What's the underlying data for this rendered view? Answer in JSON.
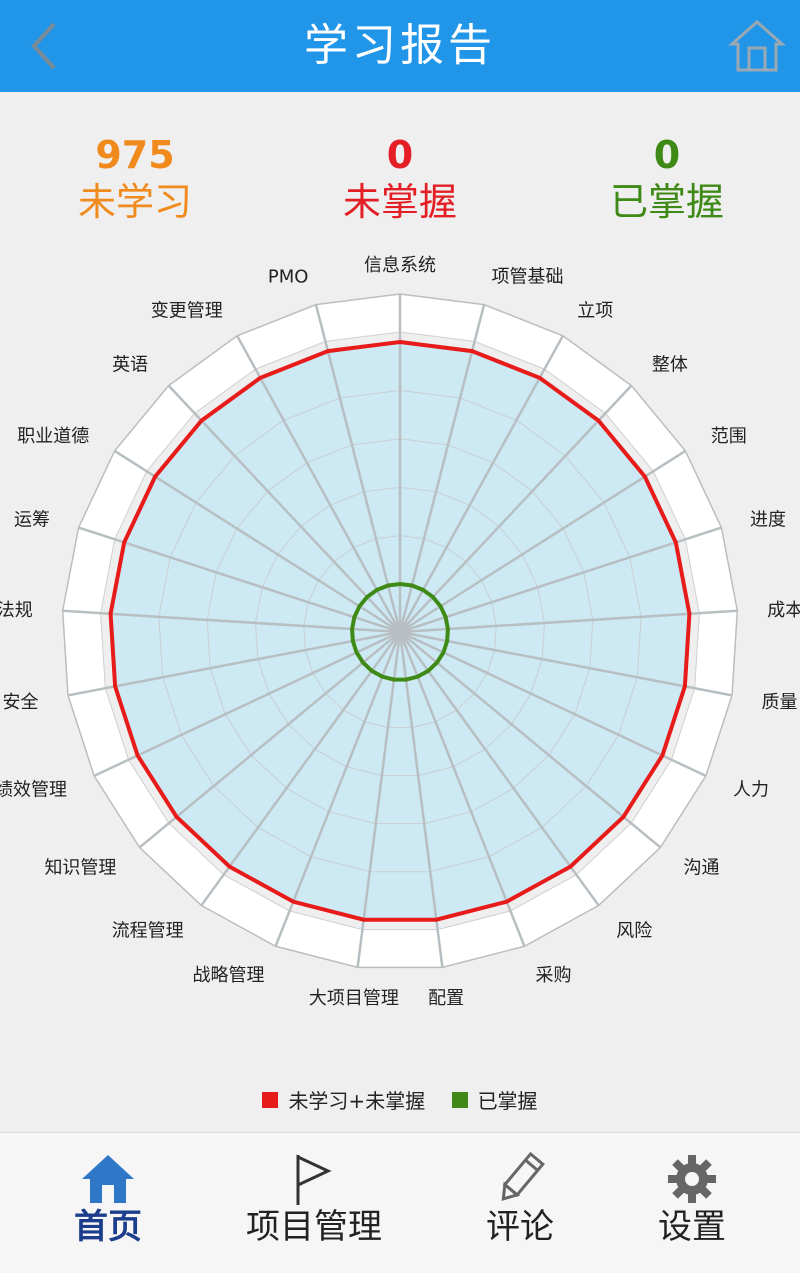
{
  "header": {
    "title": "学习报告",
    "back_icon": "chevron-left-icon",
    "home_icon": "home-icon"
  },
  "stats": [
    {
      "value": "975",
      "label": "未学习",
      "color": "#f08a1c"
    },
    {
      "value": "0",
      "label": "未掌握",
      "color": "#e31e24"
    },
    {
      "value": "0",
      "label": "已掌握",
      "color": "#3f8a16"
    }
  ],
  "chart_data": {
    "type": "radar",
    "categories": [
      "信息系统",
      "项管基础",
      "立项",
      "整体",
      "范围",
      "进度",
      "成本",
      "质量",
      "人力",
      "沟通",
      "风险",
      "采购",
      "配置",
      "大项目管理",
      "战略管理",
      "流程管理",
      "知识管理",
      "绩效管理",
      "安全",
      "法规",
      "运筹",
      "职业道德",
      "英语",
      "变更管理",
      "PMO"
    ],
    "series": [
      {
        "name": "未学习+未掌握",
        "color": "#e81b1b",
        "values": [
          100,
          100,
          100,
          100,
          100,
          100,
          100,
          100,
          100,
          100,
          100,
          100,
          100,
          100,
          100,
          100,
          100,
          100,
          100,
          100,
          100,
          100,
          100,
          100,
          100
        ]
      },
      {
        "name": "已掌握",
        "color": "#3f8a16",
        "values": [
          0,
          0,
          0,
          0,
          0,
          0,
          0,
          0,
          0,
          0,
          0,
          0,
          0,
          0,
          0,
          0,
          0,
          0,
          0,
          0,
          0,
          0,
          0,
          0,
          0
        ]
      }
    ],
    "legend_position": "bottom",
    "grid": true
  },
  "legend": [
    {
      "label": "未学习+未掌握",
      "color": "#e81b1b"
    },
    {
      "label": "已掌握",
      "color": "#3f8a16"
    }
  ],
  "nav": [
    {
      "label": "首页",
      "icon": "home-icon",
      "active": true
    },
    {
      "label": "项目管理",
      "icon": "flag-icon",
      "active": false
    },
    {
      "label": "评论",
      "icon": "pencil-icon",
      "active": false
    },
    {
      "label": "设置",
      "icon": "gear-icon",
      "active": false
    }
  ]
}
